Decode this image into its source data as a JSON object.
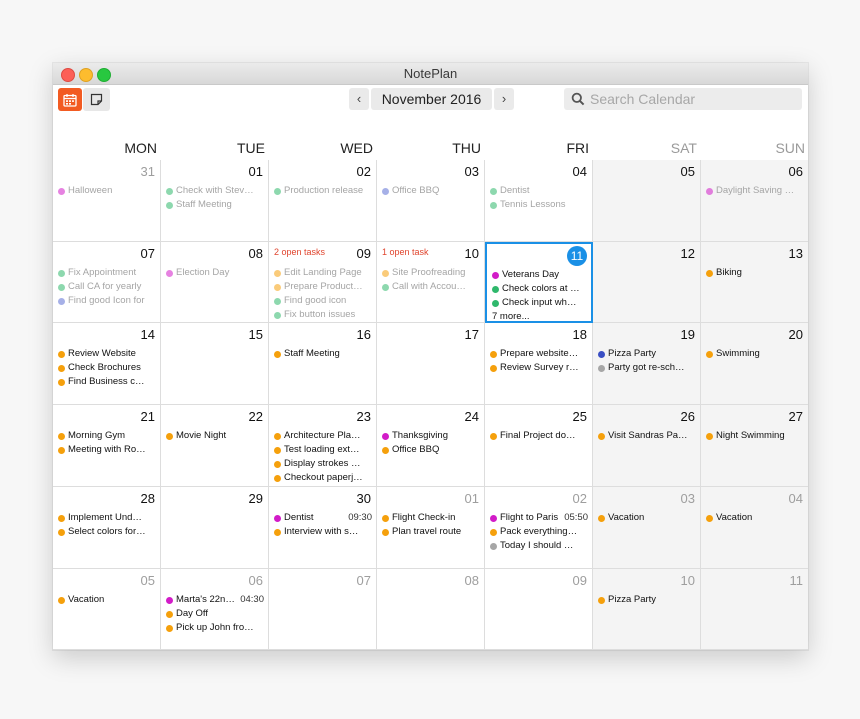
{
  "app_title": "NotePlan",
  "toolbar": {
    "calendar_icon": "calendar-icon",
    "note_icon": "note-icon",
    "prev": "‹",
    "next": "›",
    "month": "November 2016",
    "search_placeholder": "Search Calendar",
    "search_value": ""
  },
  "weekdays": [
    "MON",
    "TUE",
    "WED",
    "THU",
    "FRI",
    "SAT",
    "SUN"
  ],
  "colors": {
    "accent": "#f25b22",
    "today": "#1a90e6",
    "open_tasks": "#e0452e",
    "magenta": "#d21cc8",
    "green": "#2fb86c",
    "blue": "#5c6fd3",
    "orange": "#f5a00c",
    "gray": "#a6a6a6",
    "navy": "#3a4fc4"
  },
  "weeks": [
    [
      {
        "day": "31",
        "dim": true,
        "past": true,
        "events": [
          {
            "label": "Halloween",
            "color": "magenta"
          }
        ]
      },
      {
        "day": "01",
        "past": true,
        "events": [
          {
            "label": "Check with Stev…",
            "color": "green"
          },
          {
            "label": "Staff Meeting",
            "color": "green"
          }
        ]
      },
      {
        "day": "02",
        "past": true,
        "events": [
          {
            "label": "Production release",
            "color": "green"
          }
        ]
      },
      {
        "day": "03",
        "past": true,
        "events": [
          {
            "label": "Office BBQ",
            "color": "blue"
          }
        ]
      },
      {
        "day": "04",
        "past": true,
        "events": [
          {
            "label": "Dentist",
            "color": "green"
          },
          {
            "label": "Tennis Lessons",
            "color": "green"
          }
        ]
      },
      {
        "day": "05",
        "weekend": true,
        "past": true,
        "events": []
      },
      {
        "day": "06",
        "weekend": true,
        "past": true,
        "events": [
          {
            "label": "Daylight Saving …",
            "color": "magenta"
          }
        ]
      }
    ],
    [
      {
        "day": "07",
        "past": true,
        "events": [
          {
            "label": "Fix Appointment",
            "color": "green"
          },
          {
            "label": "Call CA for yearly",
            "color": "green"
          },
          {
            "label": "Find good Icon for",
            "color": "blue"
          }
        ]
      },
      {
        "day": "08",
        "past": true,
        "events": [
          {
            "label": "Election Day",
            "color": "magenta"
          }
        ]
      },
      {
        "day": "09",
        "past": true,
        "open_tasks": "2 open tasks",
        "events": [
          {
            "label": "Edit Landing Page",
            "color": "orange"
          },
          {
            "label": "Prepare Product…",
            "color": "orange"
          },
          {
            "label": "Find good icon",
            "color": "green"
          },
          {
            "label": "Fix button issues",
            "color": "green"
          }
        ]
      },
      {
        "day": "10",
        "past": true,
        "open_tasks": "1 open task",
        "events": [
          {
            "label": "Site Proofreading",
            "color": "orange"
          },
          {
            "label": "Call with Accou…",
            "color": "green"
          }
        ]
      },
      {
        "day": "11",
        "today": true,
        "events": [
          {
            "label": "Veterans Day",
            "color": "magenta"
          },
          {
            "label": "Check colors at …",
            "color": "green"
          },
          {
            "label": "Check input wh…",
            "color": "green"
          }
        ],
        "more": "7 more..."
      },
      {
        "day": "12",
        "weekend": true,
        "events": []
      },
      {
        "day": "13",
        "weekend": true,
        "events": [
          {
            "label": "Biking",
            "color": "orange"
          }
        ]
      }
    ],
    [
      {
        "day": "14",
        "events": [
          {
            "label": "Review Website",
            "color": "orange"
          },
          {
            "label": "Check Brochures",
            "color": "orange"
          },
          {
            "label": "Find Business c…",
            "color": "orange"
          }
        ]
      },
      {
        "day": "15",
        "events": []
      },
      {
        "day": "16",
        "events": [
          {
            "label": "Staff Meeting",
            "color": "orange"
          }
        ]
      },
      {
        "day": "17",
        "events": []
      },
      {
        "day": "18",
        "events": [
          {
            "label": "Prepare website…",
            "color": "orange"
          },
          {
            "label": "Review Survey r…",
            "color": "orange"
          }
        ]
      },
      {
        "day": "19",
        "weekend": true,
        "events": [
          {
            "label": "Pizza Party",
            "color": "navy"
          },
          {
            "label": "Party got re-sch…",
            "color": "gray"
          }
        ]
      },
      {
        "day": "20",
        "weekend": true,
        "events": [
          {
            "label": "Swimming",
            "color": "orange"
          }
        ]
      }
    ],
    [
      {
        "day": "21",
        "events": [
          {
            "label": "Morning Gym",
            "color": "orange"
          },
          {
            "label": "Meeting with Ro…",
            "color": "orange"
          }
        ]
      },
      {
        "day": "22",
        "events": [
          {
            "label": "Movie Night",
            "color": "orange"
          }
        ]
      },
      {
        "day": "23",
        "events": [
          {
            "label": "Architecture Pla…",
            "color": "orange"
          },
          {
            "label": "Test loading ext…",
            "color": "orange"
          },
          {
            "label": "Display strokes …",
            "color": "orange"
          },
          {
            "label": "Checkout paperj…",
            "color": "orange"
          }
        ]
      },
      {
        "day": "24",
        "events": [
          {
            "label": "Thanksgiving",
            "color": "magenta"
          },
          {
            "label": "Office BBQ",
            "color": "orange"
          }
        ]
      },
      {
        "day": "25",
        "events": [
          {
            "label": "Final Project do…",
            "color": "orange"
          }
        ]
      },
      {
        "day": "26",
        "weekend": true,
        "events": [
          {
            "label": "Visit Sandras Pa…",
            "color": "orange"
          }
        ]
      },
      {
        "day": "27",
        "weekend": true,
        "events": [
          {
            "label": "Night Swimming",
            "color": "orange"
          }
        ]
      }
    ],
    [
      {
        "day": "28",
        "events": [
          {
            "label": "Implement Und…",
            "color": "orange"
          },
          {
            "label": "Select colors for…",
            "color": "orange"
          }
        ]
      },
      {
        "day": "29",
        "events": []
      },
      {
        "day": "30",
        "events": [
          {
            "label": "Dentist",
            "color": "magenta",
            "time": "09:30"
          },
          {
            "label": "Interview with s…",
            "color": "orange"
          }
        ]
      },
      {
        "day": "01",
        "dim": true,
        "events": [
          {
            "label": "Flight Check-in",
            "color": "orange"
          },
          {
            "label": "Plan travel route",
            "color": "orange"
          }
        ]
      },
      {
        "day": "02",
        "dim": true,
        "events": [
          {
            "label": "Flight to Paris",
            "color": "magenta",
            "time": "05:50"
          },
          {
            "label": "Pack everything…",
            "color": "orange"
          },
          {
            "label": "Today I should …",
            "color": "gray"
          }
        ]
      },
      {
        "day": "03",
        "dim": true,
        "weekend": true,
        "events": [
          {
            "label": "Vacation",
            "color": "orange"
          }
        ]
      },
      {
        "day": "04",
        "dim": true,
        "weekend": true,
        "events": [
          {
            "label": "Vacation",
            "color": "orange"
          }
        ]
      }
    ],
    [
      {
        "day": "05",
        "dim": true,
        "events": [
          {
            "label": "Vacation",
            "color": "orange"
          }
        ]
      },
      {
        "day": "06",
        "dim": true,
        "events": [
          {
            "label": "Marta's 22n…",
            "color": "magenta",
            "time": "04:30"
          },
          {
            "label": "Day Off",
            "color": "orange"
          },
          {
            "label": "Pick up John fro…",
            "color": "orange"
          }
        ]
      },
      {
        "day": "07",
        "dim": true,
        "events": []
      },
      {
        "day": "08",
        "dim": true,
        "events": []
      },
      {
        "day": "09",
        "dim": true,
        "events": []
      },
      {
        "day": "10",
        "dim": true,
        "weekend": true,
        "events": [
          {
            "label": "Pizza Party",
            "color": "orange"
          }
        ]
      },
      {
        "day": "11",
        "dim": true,
        "weekend": true,
        "events": []
      }
    ]
  ]
}
